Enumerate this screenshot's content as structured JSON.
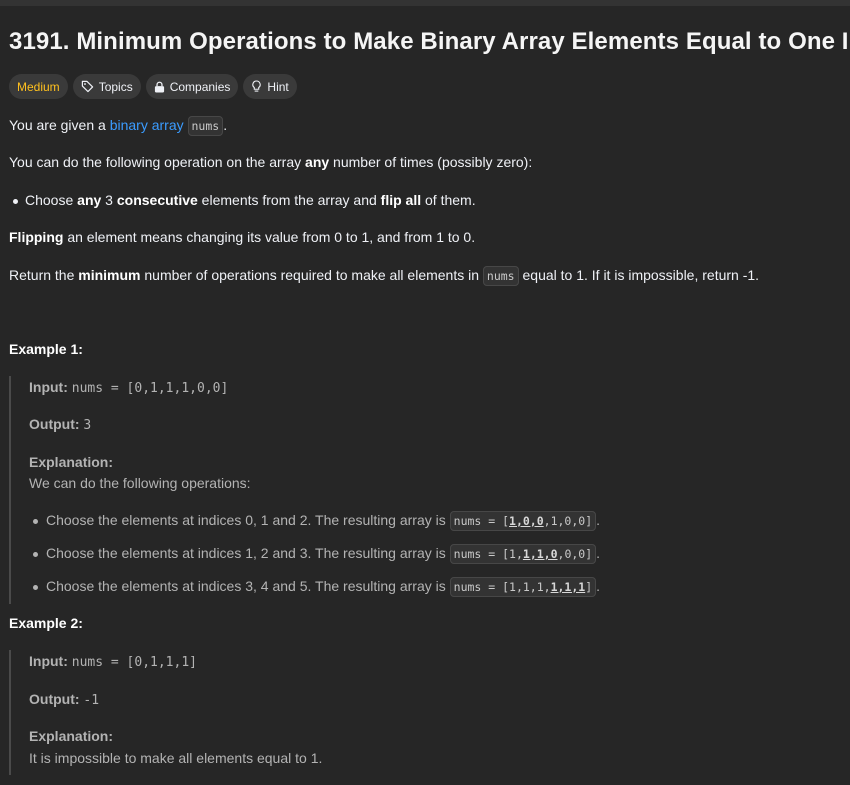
{
  "problem": {
    "title": "3191. Minimum Operations to Make Binary Array Elements Equal to One I",
    "tags": {
      "difficulty": "Medium",
      "topics": "Topics",
      "companies": "Companies",
      "hint": "Hint"
    },
    "p1": {
      "pre": "You are given a ",
      "link": "binary array",
      "code": "nums",
      "post": "."
    },
    "p2": {
      "pre": "You can do the following operation on the array ",
      "bold": "any",
      "post": " number of times (possibly zero):"
    },
    "bullet": {
      "a": "Choose ",
      "b": "any",
      "c": " 3 ",
      "d": "consecutive",
      "e": " elements from the array and ",
      "f": "flip all",
      "g": " of them."
    },
    "p3": {
      "bold": "Flipping",
      "post": " an element means changing its value from 0 to 1, and from 1 to 0."
    },
    "p4": {
      "pre": "Return the ",
      "bold": "minimum",
      "mid": " number of operations required to make all elements in ",
      "code": "nums",
      "post": " equal to 1. If it is impossible, return -1."
    }
  },
  "examples": [
    {
      "heading": "Example 1:",
      "input_label": "Input:",
      "input": "nums = [0,1,1,1,0,0]",
      "output_label": "Output:",
      "output": "3",
      "explanation_label": "Explanation:",
      "explanation": "We can do the following operations:",
      "steps": [
        {
          "text": "Choose the elements at indices 0, 1 and 2. The resulting array is",
          "prefix": "nums = [",
          "flipped": "1,0,0",
          "rest": ",1,0,0]"
        },
        {
          "text": "Choose the elements at indices 1, 2 and 3. The resulting array is",
          "prefix": "nums = [1,",
          "flipped": "1,1,0",
          "rest": ",0,0]"
        },
        {
          "text": "Choose the elements at indices 3, 4 and 5. The resulting array is",
          "prefix": "nums = [1,1,1,",
          "flipped": "1,1,1",
          "rest": "]"
        }
      ]
    },
    {
      "heading": "Example 2:",
      "input_label": "Input:",
      "input": "nums = [0,1,1,1]",
      "output_label": "Output:",
      "output": "-1",
      "explanation_label": "Explanation:",
      "explanation": "It is impossible to make all elements equal to 1."
    }
  ],
  "colors": {
    "background": "#262626",
    "difficulty_medium": "#ffc01e",
    "link": "#3b9cff"
  },
  "icons": [
    "tag-icon",
    "lock-icon",
    "lightbulb-icon"
  ]
}
